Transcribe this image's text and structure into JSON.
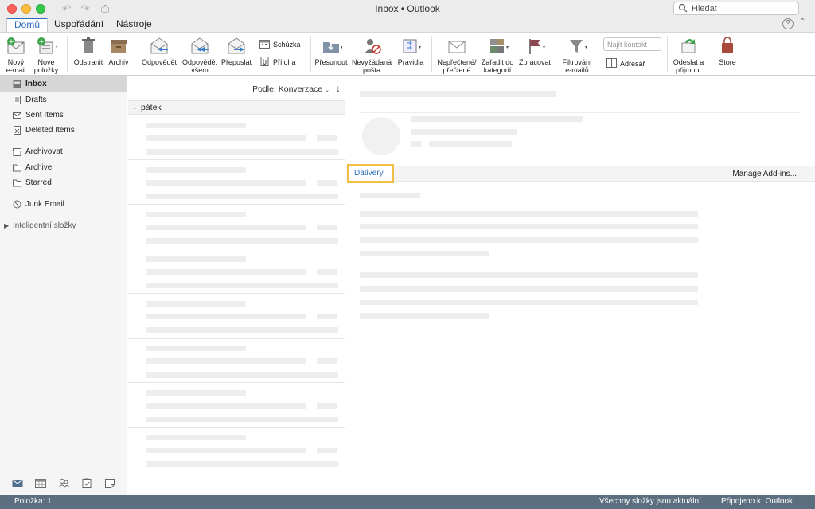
{
  "window": {
    "title": "Inbox • Outlook",
    "search_placeholder": "Hledat"
  },
  "tabs": [
    {
      "label": "Domů",
      "active": true
    },
    {
      "label": "Uspořádání",
      "active": false
    },
    {
      "label": "Nástroje",
      "active": false
    }
  ],
  "ribbon": {
    "new_email": "Nový e-mail",
    "new_items": "Nové položky",
    "delete": "Odstranit",
    "archive": "Archiv",
    "reply": "Odpovědět",
    "reply_all": "Odpovědět všem",
    "forward": "Přeposlat",
    "meeting": "Schůzka",
    "attachment": "Příloha",
    "move": "Přesunout",
    "junk": "Nevyžádaná pošta",
    "rules": "Pravidla",
    "unread_read": "Nepřečtené/ přečtené",
    "categorize": "Zařadit do kategorií",
    "follow_up": "Zpracovat",
    "filter": "Filtrování e-mailů",
    "find_contact_placeholder": "Najít kontakt",
    "address_book": "Adresář",
    "send_receive": "Odeslat a přijmout",
    "store": "Store"
  },
  "sidebar": {
    "items": [
      {
        "label": "Inbox",
        "icon": "inbox-icon",
        "selected": true
      },
      {
        "label": "Drafts",
        "icon": "drafts-icon"
      },
      {
        "label": "Sent Items",
        "icon": "sent-icon"
      },
      {
        "label": "Deleted Items",
        "icon": "deleted-icon"
      },
      {
        "label": "Archivovat",
        "icon": "archive-folder-icon"
      },
      {
        "label": "Archive",
        "icon": "folder-icon"
      },
      {
        "label": "Starred",
        "icon": "folder-icon"
      },
      {
        "label": "Junk Email",
        "icon": "junk-icon"
      }
    ],
    "smart_folders": "Inteligentní složky",
    "bottom_icons": [
      "mail-icon",
      "calendar-icon",
      "people-icon",
      "tasks-icon",
      "notes-icon"
    ]
  },
  "message_list": {
    "sort_label": "Podle: Konverzace",
    "group_label": "pátek"
  },
  "reading_pane": {
    "addin_label": "Dativery",
    "manage_addins": "Manage Add-ins..."
  },
  "status": {
    "left": "Položka: 1",
    "middle": "Všechny složky jsou aktuální.",
    "right": "Připojeno k: Outlook"
  },
  "colors": {
    "accent": "#2a6ebb",
    "highlight": "#efbf45",
    "statusbar": "#5c6f80"
  }
}
